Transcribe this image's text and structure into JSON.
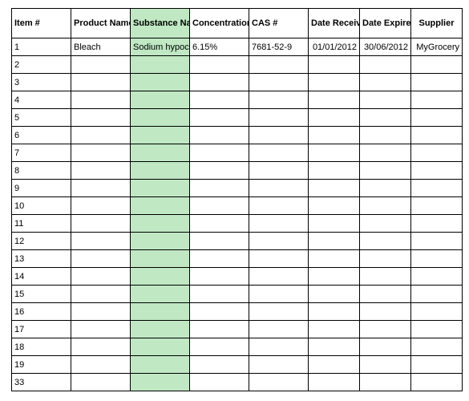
{
  "colors": {
    "highlight": "#bfe8c3"
  },
  "columns": [
    {
      "label": "Item #",
      "align": "left"
    },
    {
      "label": "Product Name",
      "align": "left"
    },
    {
      "label": "Substance Name",
      "align": "left",
      "highlight": true
    },
    {
      "label": "Concentration",
      "align": "left"
    },
    {
      "label": "CAS #",
      "align": "left"
    },
    {
      "label": "Date Received",
      "align": "center"
    },
    {
      "label": "Date Expired",
      "align": "center"
    },
    {
      "label": "Supplier",
      "align": "center"
    }
  ],
  "rows": [
    {
      "item": "1",
      "product": "Bleach",
      "substance": "Sodium hypochlorite",
      "concentration": "6.15%",
      "cas": "7681-52-9",
      "received": "01/01/2012",
      "expired": "30/06/2012",
      "supplier": "MyGrocery"
    },
    {
      "item": "2",
      "product": "",
      "substance": "",
      "concentration": "",
      "cas": "",
      "received": "",
      "expired": "",
      "supplier": ""
    },
    {
      "item": "3",
      "product": "",
      "substance": "",
      "concentration": "",
      "cas": "",
      "received": "",
      "expired": "",
      "supplier": ""
    },
    {
      "item": "4",
      "product": "",
      "substance": "",
      "concentration": "",
      "cas": "",
      "received": "",
      "expired": "",
      "supplier": ""
    },
    {
      "item": "5",
      "product": "",
      "substance": "",
      "concentration": "",
      "cas": "",
      "received": "",
      "expired": "",
      "supplier": ""
    },
    {
      "item": "6",
      "product": "",
      "substance": "",
      "concentration": "",
      "cas": "",
      "received": "",
      "expired": "",
      "supplier": ""
    },
    {
      "item": "7",
      "product": "",
      "substance": "",
      "concentration": "",
      "cas": "",
      "received": "",
      "expired": "",
      "supplier": ""
    },
    {
      "item": "8",
      "product": "",
      "substance": "",
      "concentration": "",
      "cas": "",
      "received": "",
      "expired": "",
      "supplier": ""
    },
    {
      "item": "9",
      "product": "",
      "substance": "",
      "concentration": "",
      "cas": "",
      "received": "",
      "expired": "",
      "supplier": ""
    },
    {
      "item": "10",
      "product": "",
      "substance": "",
      "concentration": "",
      "cas": "",
      "received": "",
      "expired": "",
      "supplier": ""
    },
    {
      "item": "11",
      "product": "",
      "substance": "",
      "concentration": "",
      "cas": "",
      "received": "",
      "expired": "",
      "supplier": ""
    },
    {
      "item": "12",
      "product": "",
      "substance": "",
      "concentration": "",
      "cas": "",
      "received": "",
      "expired": "",
      "supplier": ""
    },
    {
      "item": "13",
      "product": "",
      "substance": "",
      "concentration": "",
      "cas": "",
      "received": "",
      "expired": "",
      "supplier": ""
    },
    {
      "item": "14",
      "product": "",
      "substance": "",
      "concentration": "",
      "cas": "",
      "received": "",
      "expired": "",
      "supplier": ""
    },
    {
      "item": "15",
      "product": "",
      "substance": "",
      "concentration": "",
      "cas": "",
      "received": "",
      "expired": "",
      "supplier": ""
    },
    {
      "item": "16",
      "product": "",
      "substance": "",
      "concentration": "",
      "cas": "",
      "received": "",
      "expired": "",
      "supplier": ""
    },
    {
      "item": "17",
      "product": "",
      "substance": "",
      "concentration": "",
      "cas": "",
      "received": "",
      "expired": "",
      "supplier": ""
    },
    {
      "item": "18",
      "product": "",
      "substance": "",
      "concentration": "",
      "cas": "",
      "received": "",
      "expired": "",
      "supplier": ""
    },
    {
      "item": "19",
      "product": "",
      "substance": "",
      "concentration": "",
      "cas": "",
      "received": "",
      "expired": "",
      "supplier": ""
    },
    {
      "item": "33",
      "product": "",
      "substance": "",
      "concentration": "",
      "cas": "",
      "received": "",
      "expired": "",
      "supplier": ""
    }
  ]
}
